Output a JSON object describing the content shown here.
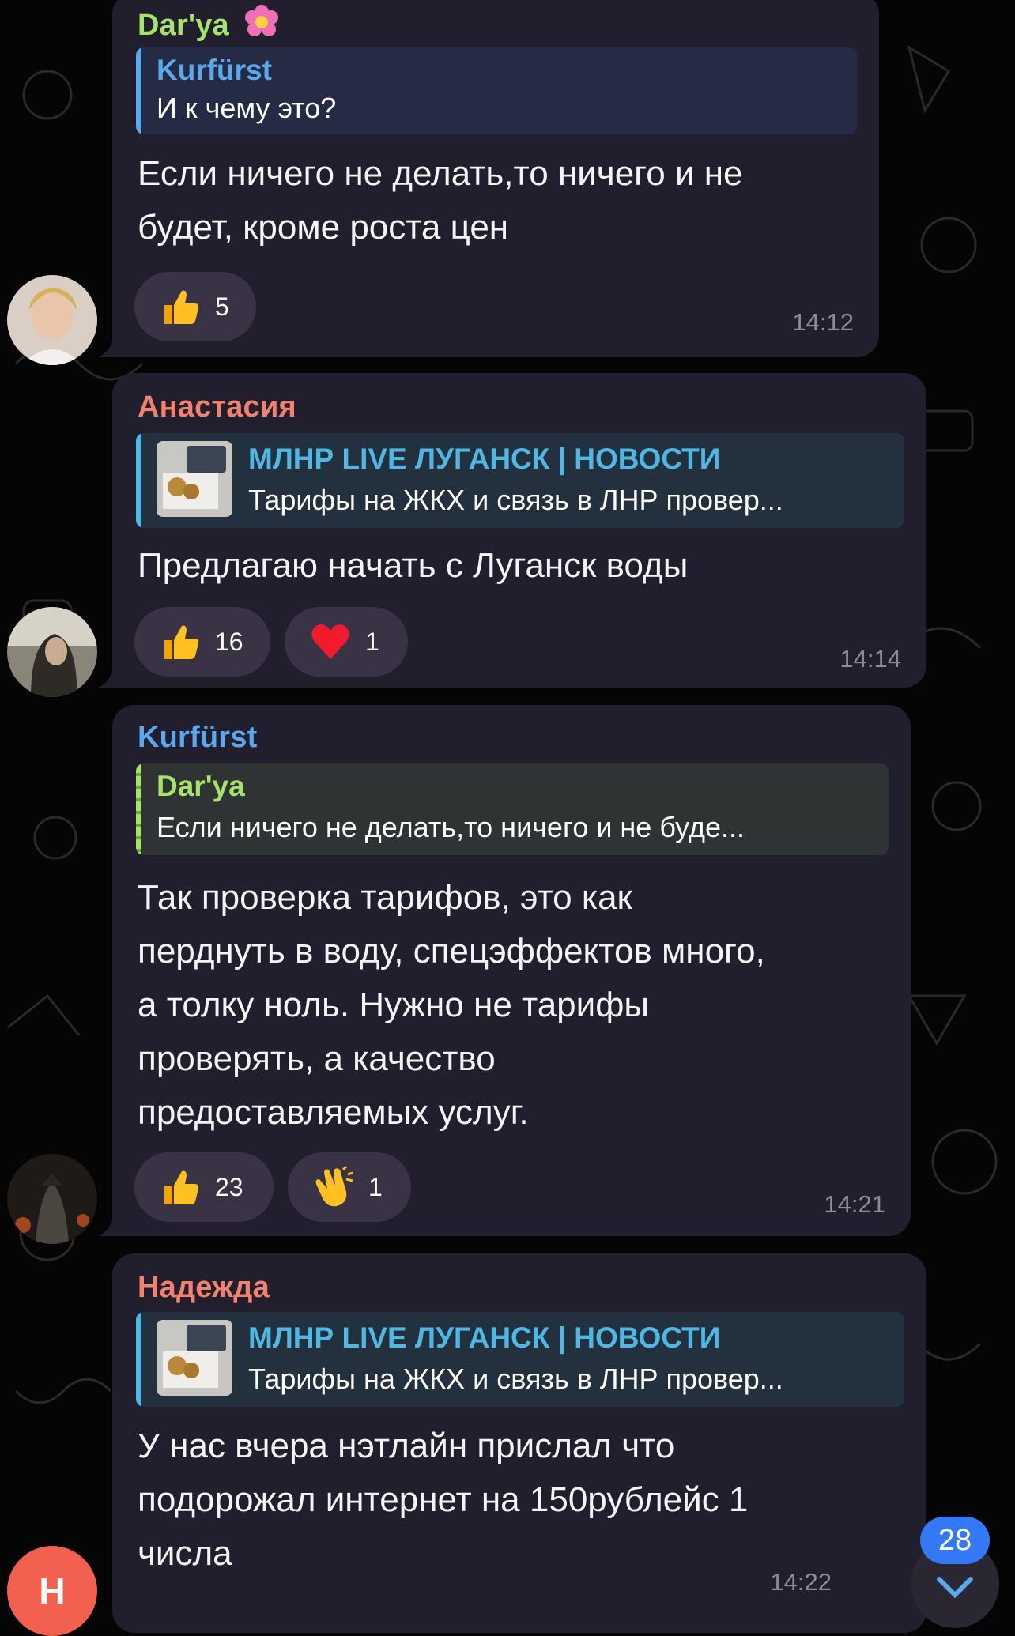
{
  "messages": [
    {
      "sender": "Dar'ya",
      "sender_color": "#a6e36a",
      "reply": {
        "name": "Kurfürst",
        "text": "И к чему это?",
        "color": "#5aa8ee"
      },
      "text": "Если ничего не делать,то ничего и не\nбудет,  кроме роста цен",
      "reactions": [
        {
          "icon": "thumbs-up-icon",
          "count": "5"
        }
      ],
      "time": "14:12"
    },
    {
      "sender": "Анастасия",
      "sender_color": "#f2826d",
      "reply": {
        "name": "МЛНР LIVE ЛУГАНСК | НОВОСТИ",
        "text": "Тарифы на ЖКХ и связь в ЛНР провер...",
        "color": "#4fb7e3"
      },
      "text": "Предлагаю начать с Луганск воды",
      "reactions": [
        {
          "icon": "thumbs-up-icon",
          "count": "16"
        },
        {
          "icon": "red-heart-icon",
          "count": "1"
        }
      ],
      "time": "14:14"
    },
    {
      "sender": "Kurfürst",
      "sender_color": "#5aa8ee",
      "reply": {
        "name": "Dar'ya",
        "text": "Если ничего не делать,то ничего и не буде...",
        "color": "#a6e36a"
      },
      "text": "Так проверка тарифов, это как\nперднуть в воду, спецэффектов много,\nа толку ноль. Нужно не тарифы\nпроверять, а качество\nпредоставляемых услуг.",
      "reactions": [
        {
          "icon": "thumbs-up-icon",
          "count": "23"
        },
        {
          "icon": "clapping-hands-icon",
          "count": "1"
        }
      ],
      "time": "14:21"
    },
    {
      "sender": "Надежда",
      "sender_color": "#f2826d",
      "reply": {
        "name": "МЛНР LIVE ЛУГАНСК | НОВОСТИ",
        "text": "Тарифы на ЖКХ и связь в ЛНР провер...",
        "color": "#4fb7e3"
      },
      "text": "У нас вчера нэтлайн прислал что\nподорожал интернет на 150рублейс 1\nчисла",
      "reactions": [],
      "time": "14:22"
    }
  ],
  "avatar_initial": "Н",
  "avatar_initial_color": "#f2604f",
  "unread_count": "28",
  "icons": {
    "scroll_down": "chevron-down-icon",
    "sender_decoration": "flower-icon"
  }
}
